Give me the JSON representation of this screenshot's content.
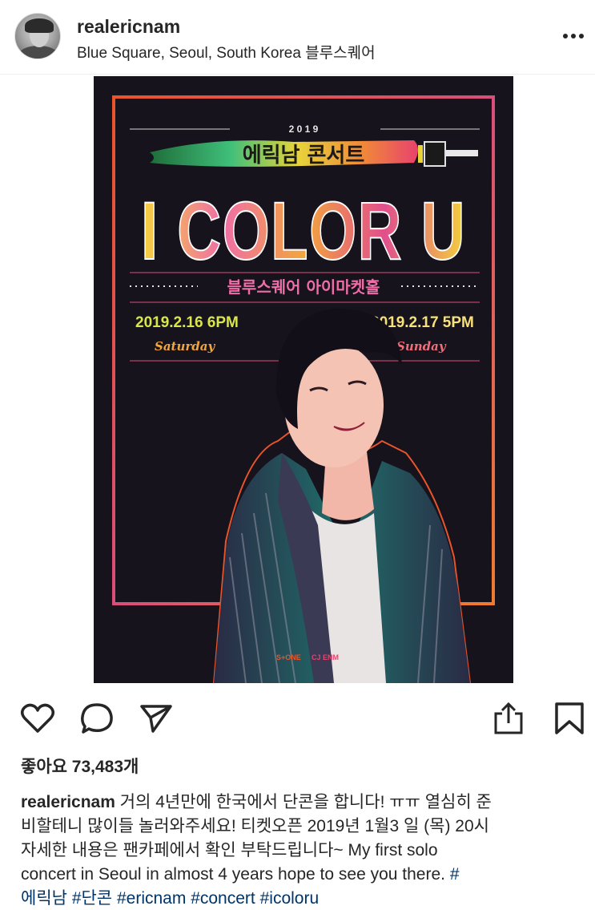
{
  "post": {
    "username": "realericnam",
    "location": "Blue Square, Seoul, South Korea 블루스퀘어"
  },
  "poster": {
    "year": "2 0 1 9",
    "korean_title": "에릭남 콘서트",
    "title": "I COLOR U",
    "venue": "블루스퀘어 아이마켓홀",
    "date1": "2019.2.16 6PM",
    "day1": "Saturday",
    "date2": "2019.2.17 5PM",
    "day2": "Sunday",
    "sponsor1": "S+ONE",
    "sponsor2": "CJ ENM"
  },
  "actions": {
    "like_icon": "heart-icon",
    "comment_icon": "comment-icon",
    "share_icon": "paper-plane-icon",
    "upload_icon": "share-upload-icon",
    "save_icon": "bookmark-icon"
  },
  "likes_text": "좋아요 73,483개",
  "caption": {
    "username": "realericnam",
    "line1": " 거의 4년만에 한국에서 단콘을 합니다! ㅠㅠ 열심히 준",
    "line2": "비할테니 많이들 놀러와주세요! 티켓오픈 2019년 1월3 일 (목) 20시",
    "line3": "자세한 내용은 팬카페에서 확인 부탁드립니다~ My first solo",
    "line4": "concert in Seoul in almost 4 years hope to see you there. ",
    "tag_hash": "#",
    "tag1": "에릭남",
    "tag2": "#단콘",
    "tag3": "#ericnam",
    "tag4": "#concert",
    "tag5": "#icoloru"
  },
  "colors": {
    "text": "#262626",
    "hashtag": "#003569",
    "poster_bg": "#16131c"
  }
}
